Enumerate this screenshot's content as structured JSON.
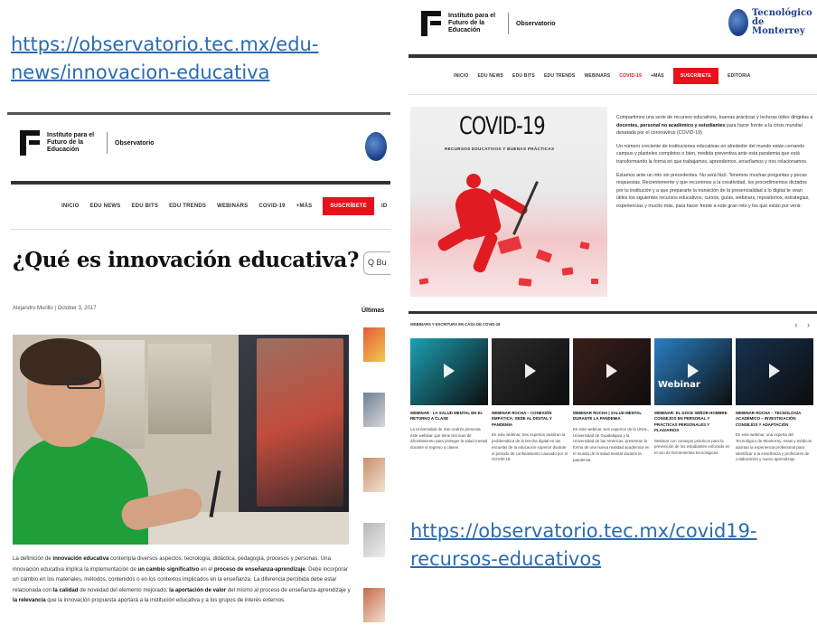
{
  "urls": {
    "left": "https://observatorio.tec.mx/edu-news/innovacion-educativa",
    "right": "https://observatorio.tec.mx/covid19-recursos-educativos"
  },
  "brand": {
    "institute": "Instituto para el Futuro de la Educación",
    "section": "Observatorio",
    "tec": "Tecnológico de Monterrey"
  },
  "left_page": {
    "nav": [
      "INICIO",
      "EDU NEWS",
      "EDU BITS",
      "EDU TRENDS",
      "WEBINARS",
      "COVID-19",
      "+MÁS",
      "SUSCRÍBETE",
      "ID"
    ],
    "nav_active_index": 7,
    "title": "¿Qué es innovación educativa?",
    "search_placeholder": "Q Bu",
    "byline": "Alejandro Murillo | October 3, 2017",
    "sidebar_label": "Últimas",
    "body_parts": [
      {
        "t": "La definición de ",
        "b": false
      },
      {
        "t": "innovación educativa",
        "b": true
      },
      {
        "t": " contempla diversos aspectos: tecnología, didáctica, pedagogía, procesos y personas. Una innovación educativa implica la implementación de ",
        "b": false
      },
      {
        "t": "un cambio significativo",
        "b": true
      },
      {
        "t": " en el ",
        "b": false
      },
      {
        "t": "proceso de enseñanza-aprendizaje",
        "b": true
      },
      {
        "t": ". Debe incorporar un cambio en los materiales, métodos, contenidos o en los contextos implicados en la enseñanza. La diferencia percibida debe estar relacionada con ",
        "b": false
      },
      {
        "t": "la calidad",
        "b": true
      },
      {
        "t": " de novedad del elemento mejorado, ",
        "b": false
      },
      {
        "t": "la aportación de valor",
        "b": true
      },
      {
        "t": " del mismo al proceso de enseñanza-aprendizaje y ",
        "b": false
      },
      {
        "t": "la relevancia",
        "b": true
      },
      {
        "t": " que la innovación propuesta aportará a la institución educativa y a los grupos de interés externos.",
        "b": false
      }
    ]
  },
  "right_page": {
    "nav": [
      "INICIO",
      "EDU NEWS",
      "EDU BITS",
      "EDU TRENDS",
      "WEBINARS",
      "COVID-19",
      "+MÁS",
      "SUSCRÍBETE",
      "EDITORIA"
    ],
    "nav_red_index": 5,
    "nav_active_index": 7,
    "banner_title": "COVID-19",
    "banner_subtitle": "RECURSOS EDUCATIVOS Y BUENAS PRÁCTICAS",
    "intro_parts": [
      [
        {
          "t": "Compartimos una serie de recursos educativos, buenas prácticas y lecturas útiles dirigidas a ",
          "b": false
        },
        {
          "t": "docentes, personal no académico y estudiantes",
          "b": true
        },
        {
          "t": " para hacer frente a la crisis mundial desatada por el coronavirus (COVID-19).",
          "b": false
        }
      ],
      [
        {
          "t": "Un número creciente de instituciones educativas en alrededor del mundo están cerrando campus y planteles completos o bien, medida preventiva ante esta pandemia que está transformando la forma en que trabajamos, aprendemos, enseñamos y nos relacionamos.",
          "b": false
        }
      ],
      [
        {
          "t": "Estamos ante un reto sin precedentes. No será fácil. Tenemos muchas preguntas y pocas respuestas. Recientemente y que recurrimos a la creatividad, los procedimientos dictados por tu institución y a que prepararte la transición de la presencialidad a lo digital te vean útiles los siguientes recursos educativos, cursos, guías, webinars, repositorios, estrategias, experiencias y mucho más, para hacer frente a este gran reto y los que están por venir.",
          "b": false
        }
      ]
    ],
    "cards_header": "WEBINARS Y ESCRITURA EN CASA DE COVID-19",
    "cards_nav": "‹ ›",
    "cards": [
      {
        "title": "WEBINAR · LA SALUD MENTAL EN EL RETORNO A CLASE",
        "text": "La Universidad de San Andrés presenta este webinar que tiene técnicas de afrontamiento para proteger la salud mental durante el regreso a clases.",
        "thumb_label": "",
        "thumb_color": "#1ba0b3"
      },
      {
        "title": "WEBINAR ROCHA – CONEXIÓN EMPÁTICA: SEDE AL DIGITAL Y PANDEMIA",
        "text": "En este webinar, tres expertos analizan la problemática de la brecha digital en las escuelas de la educación superior durante el periodo de confinamiento causado por el COVID-19.",
        "thumb_label": "",
        "thumb_color": "#2c2c2c"
      },
      {
        "title": "WEBINAR ROCHA | SALUD MENTAL DURANTE LA PANDEMIA",
        "text": "En este webinar, tres expertos de la UNAL, Universidad de Guadalajara y la Universidad de las Américas, presentan la forma de una nueva realidad académica en el mundo de la salud mental durante la pandemia.",
        "thumb_label": "",
        "thumb_color": "#3b1f1a"
      },
      {
        "title": "WEBINAR: EL DOCE SEÑOR HOMBRE CONSEJOS EN PERSONAL Y PRÁCTICAS PERSONALES Y PLAGIARIOS",
        "text": "Webinar con consejos prácticos para la prevención de los estudiantes enfocado en el uso de herramientas tecnológicas.",
        "thumb_label": "Webinar",
        "thumb_color": "#2a7fc4"
      },
      {
        "title": "WEBINAR ROCHA – TECNOLOGÍA ACADÉMICO – INVESTIGACIÓN CONSEJOS Y ADAPTACIÓN",
        "text": "En este webinar, una experta del Tecnológico de Monterrey, Israel y médicos aportan la experiencia profesional para identificar a la enseñanza y profesores de colaboración y nuevo aprendizaje.",
        "thumb_label": "",
        "thumb_color": "#16324f"
      }
    ]
  }
}
